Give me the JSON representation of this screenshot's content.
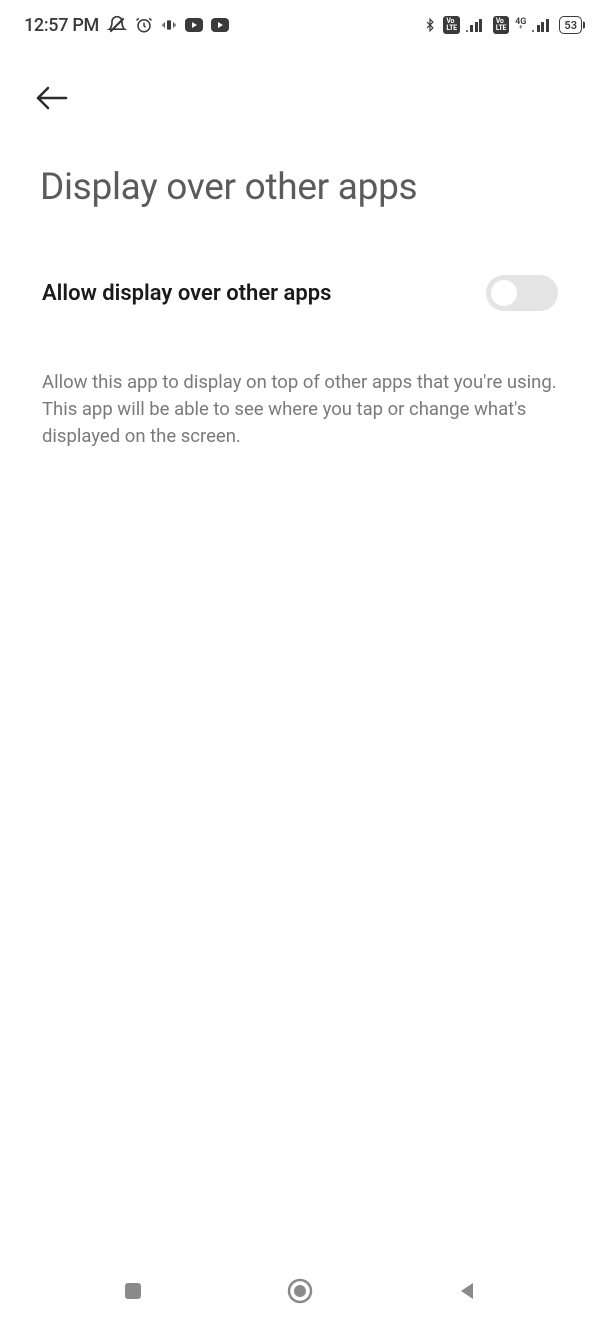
{
  "status": {
    "time": "12:57 PM",
    "battery": "53",
    "network_type": "4G"
  },
  "header": {
    "title": "Display over other apps"
  },
  "setting": {
    "label": "Allow display over other apps",
    "enabled": false
  },
  "description": "Allow this app to display on top of other apps that you're using. This app will be able to see where you tap or change what's displayed on the screen."
}
